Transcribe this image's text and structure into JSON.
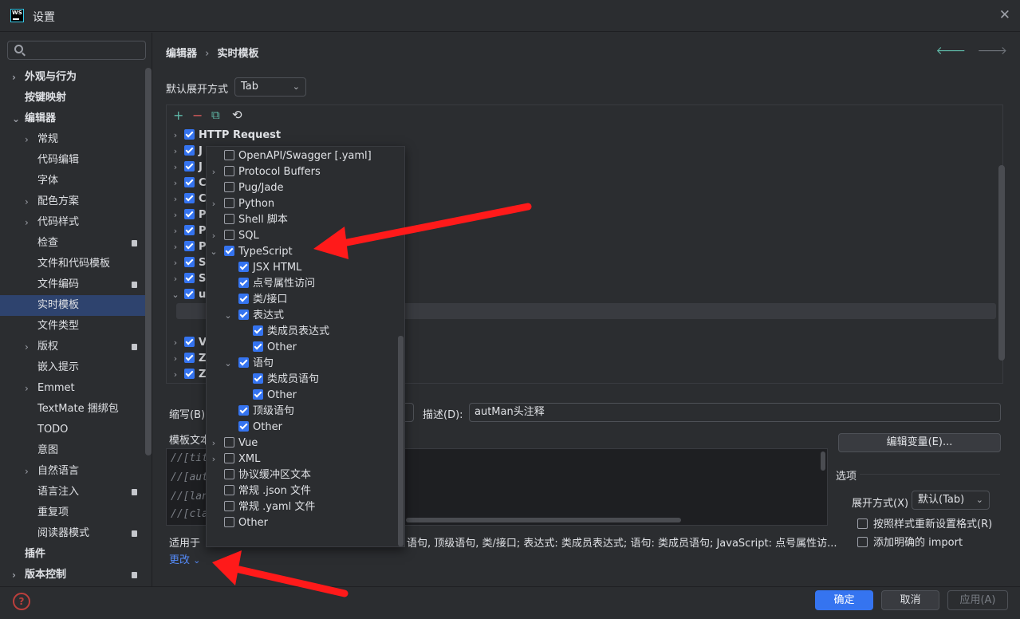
{
  "window": {
    "logo_text": "WS",
    "title": "设置",
    "close": "✕"
  },
  "sidebar": {
    "search_placeholder": "",
    "items": [
      {
        "label": "外观与行为",
        "level": 0,
        "chevron": "›",
        "bold": true,
        "badge": false
      },
      {
        "label": "按键映射",
        "level": 0,
        "chevron": "",
        "bold": true,
        "badge": false
      },
      {
        "label": "编辑器",
        "level": 0,
        "chevron": "⌄",
        "bold": true,
        "badge": false
      },
      {
        "label": "常规",
        "level": 1,
        "chevron": "›",
        "bold": false,
        "badge": false
      },
      {
        "label": "代码编辑",
        "level": 1,
        "chevron": "",
        "bold": false,
        "badge": false
      },
      {
        "label": "字体",
        "level": 1,
        "chevron": "",
        "bold": false,
        "badge": false
      },
      {
        "label": "配色方案",
        "level": 1,
        "chevron": "›",
        "bold": false,
        "badge": false
      },
      {
        "label": "代码样式",
        "level": 1,
        "chevron": "›",
        "bold": false,
        "badge": false
      },
      {
        "label": "检查",
        "level": 1,
        "chevron": "",
        "bold": false,
        "badge": true
      },
      {
        "label": "文件和代码模板",
        "level": 1,
        "chevron": "",
        "bold": false,
        "badge": false
      },
      {
        "label": "文件编码",
        "level": 1,
        "chevron": "",
        "bold": false,
        "badge": true
      },
      {
        "label": "实时模板",
        "level": 1,
        "chevron": "",
        "bold": false,
        "badge": false,
        "selected": true
      },
      {
        "label": "文件类型",
        "level": 1,
        "chevron": "",
        "bold": false,
        "badge": false
      },
      {
        "label": "版权",
        "level": 1,
        "chevron": "›",
        "bold": false,
        "badge": true
      },
      {
        "label": "嵌入提示",
        "level": 1,
        "chevron": "",
        "bold": false,
        "badge": false
      },
      {
        "label": "Emmet",
        "level": 1,
        "chevron": "›",
        "bold": false,
        "badge": false
      },
      {
        "label": "TextMate 捆绑包",
        "level": 1,
        "chevron": "",
        "bold": false,
        "badge": false
      },
      {
        "label": "TODO",
        "level": 1,
        "chevron": "",
        "bold": false,
        "badge": false
      },
      {
        "label": "意图",
        "level": 1,
        "chevron": "",
        "bold": false,
        "badge": false
      },
      {
        "label": "自然语言",
        "level": 1,
        "chevron": "›",
        "bold": false,
        "badge": false
      },
      {
        "label": "语言注入",
        "level": 1,
        "chevron": "",
        "bold": false,
        "badge": true
      },
      {
        "label": "重复项",
        "level": 1,
        "chevron": "",
        "bold": false,
        "badge": false
      },
      {
        "label": "阅读器模式",
        "level": 1,
        "chevron": "",
        "bold": false,
        "badge": true
      },
      {
        "label": "插件",
        "level": 0,
        "chevron": "",
        "bold": true,
        "badge": false
      },
      {
        "label": "版本控制",
        "level": 0,
        "chevron": "›",
        "bold": true,
        "badge": true
      }
    ]
  },
  "breadcrumb": {
    "part1": "编辑器",
    "sep": "›",
    "part2": "实时模板",
    "back": "🡐",
    "forward": "🡒"
  },
  "expand_by": {
    "label": "默认展开方式",
    "value": "Tab"
  },
  "toolbar": {
    "add": "+",
    "remove": "−",
    "copy": "⧉",
    "restore": "⟲"
  },
  "tree": {
    "rows": [
      {
        "chevron": "›",
        "label": "HTTP Request",
        "checked": true,
        "indent": 0,
        "bold": true
      },
      {
        "chevron": "›",
        "label": "J",
        "checked": true,
        "indent": 0,
        "bold": true
      },
      {
        "chevron": "›",
        "label": "J",
        "checked": true,
        "indent": 0,
        "bold": true
      },
      {
        "chevron": "›",
        "label": "C",
        "checked": true,
        "indent": 0,
        "bold": true
      },
      {
        "chevron": "›",
        "label": "C",
        "checked": true,
        "indent": 0,
        "bold": true
      },
      {
        "chevron": "›",
        "label": "P",
        "checked": true,
        "indent": 0,
        "bold": true
      },
      {
        "chevron": "›",
        "label": "P",
        "checked": true,
        "indent": 0,
        "bold": true
      },
      {
        "chevron": "›",
        "label": "P",
        "checked": true,
        "indent": 0,
        "bold": true
      },
      {
        "chevron": "›",
        "label": "S",
        "checked": true,
        "indent": 0,
        "bold": true
      },
      {
        "chevron": "›",
        "label": "S",
        "checked": true,
        "indent": 0,
        "bold": true
      },
      {
        "chevron": "⌄",
        "label": "u",
        "checked": true,
        "indent": 0,
        "bold": true
      },
      {
        "chevron": "",
        "label": "",
        "checked": true,
        "indent": 1,
        "bold": false
      },
      {
        "chevron": "",
        "label": "",
        "checked": true,
        "indent": 1,
        "bold": false
      },
      {
        "chevron": "›",
        "label": "V",
        "checked": true,
        "indent": 0,
        "bold": true
      },
      {
        "chevron": "›",
        "label": "Z",
        "checked": true,
        "indent": 0,
        "bold": true
      },
      {
        "chevron": "›",
        "label": "Z",
        "checked": true,
        "indent": 0,
        "bold": true
      }
    ]
  },
  "abbrev": {
    "label": "缩写(B):",
    "value": ""
  },
  "description": {
    "label": "描述(D):",
    "value": "autMan头注释"
  },
  "template_text": {
    "label": "模板文本",
    "lines": [
      "//[tit",
      "//[aut",
      "//[lan",
      "//[cla"
    ]
  },
  "edit_vars_button": "编辑变量(E)...",
  "options": {
    "title": "选项",
    "expand_label": "展开方式(X)",
    "expand_value": "默认(Tab)",
    "reformat": "按照样式重新设置格式(R)",
    "add_import": "添加明确的 import"
  },
  "applicable": {
    "prefix": "适用于",
    "text": "语句, 顶级语句, 类/接口; 表达式: 类成员表达式; 语句: 类成员语句; JavaScript: 点号属性访...",
    "change_link": "更改",
    "change_chevron": "⌄"
  },
  "popup": {
    "items": [
      {
        "label": "OpenAPI/Swagger [.yaml]",
        "level": 0,
        "chevron": "",
        "checked": false
      },
      {
        "label": "Protocol Buffers",
        "level": 0,
        "chevron": "›",
        "checked": false
      },
      {
        "label": "Pug/Jade",
        "level": 0,
        "chevron": "",
        "checked": false
      },
      {
        "label": "Python",
        "level": 0,
        "chevron": "›",
        "checked": false
      },
      {
        "label": "Shell 脚本",
        "level": 0,
        "chevron": "",
        "checked": false
      },
      {
        "label": "SQL",
        "level": 0,
        "chevron": "›",
        "checked": false
      },
      {
        "label": "TypeScript",
        "level": 0,
        "chevron": "⌄",
        "checked": true
      },
      {
        "label": "JSX HTML",
        "level": 1,
        "chevron": "",
        "checked": true
      },
      {
        "label": "点号属性访问",
        "level": 1,
        "chevron": "",
        "checked": true
      },
      {
        "label": "类/接口",
        "level": 1,
        "chevron": "",
        "checked": true
      },
      {
        "label": "表达式",
        "level": 1,
        "chevron": "⌄",
        "checked": true
      },
      {
        "label": "类成员表达式",
        "level": 2,
        "chevron": "",
        "checked": true
      },
      {
        "label": "Other",
        "level": 2,
        "chevron": "",
        "checked": true
      },
      {
        "label": "语句",
        "level": 1,
        "chevron": "⌄",
        "checked": true
      },
      {
        "label": "类成员语句",
        "level": 2,
        "chevron": "",
        "checked": true
      },
      {
        "label": "Other",
        "level": 2,
        "chevron": "",
        "checked": true
      },
      {
        "label": "顶级语句",
        "level": 1,
        "chevron": "",
        "checked": true
      },
      {
        "label": "Other",
        "level": 1,
        "chevron": "",
        "checked": true
      },
      {
        "label": "Vue",
        "level": 0,
        "chevron": "›",
        "checked": false
      },
      {
        "label": "XML",
        "level": 0,
        "chevron": "›",
        "checked": false
      },
      {
        "label": "协议缓冲区文本",
        "level": 0,
        "chevron": "",
        "checked": false
      },
      {
        "label": "常规 .json 文件",
        "level": 0,
        "chevron": "",
        "checked": false
      },
      {
        "label": "常规 .yaml 文件",
        "level": 0,
        "chevron": "",
        "checked": false
      },
      {
        "label": "Other",
        "level": 0,
        "chevron": "",
        "checked": false
      }
    ]
  },
  "footer": {
    "help": "?",
    "ok": "确定",
    "cancel": "取消",
    "apply": "应用(A)"
  },
  "colors": {
    "accent": "#3574f0",
    "selection": "#2e436e",
    "annotation_arrow": "#ff1a1a",
    "link": "#548af7"
  }
}
